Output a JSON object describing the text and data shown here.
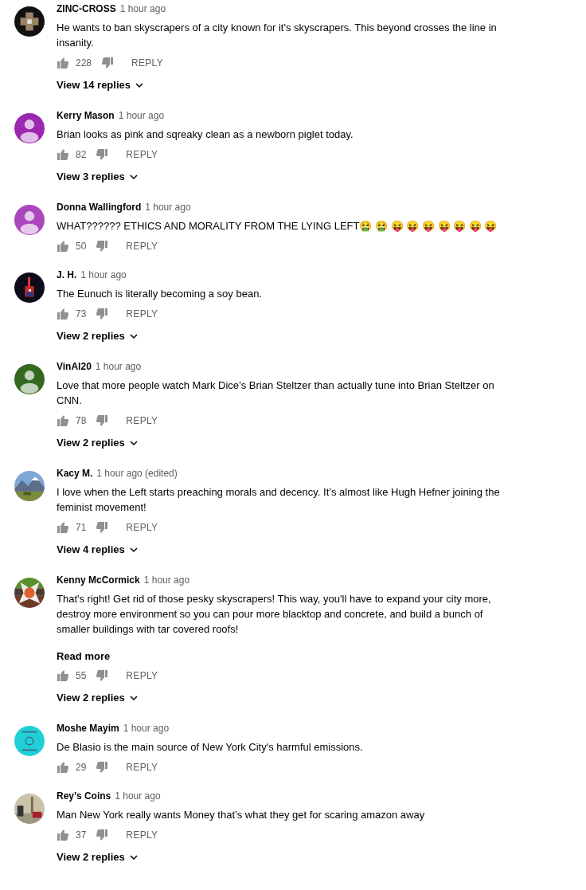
{
  "comments": [
    {
      "author": "ZINC-CROSS",
      "time": "1 hour ago",
      "text": "He wants to ban skyscrapers of a city known for it's skyscrapers. This beyond crosses the line in insanity.",
      "likes": "228",
      "reply": "REPLY",
      "replies": "View 14 replies"
    },
    {
      "author": "Kerry Mason",
      "time": "1 hour ago",
      "avatar": {
        "kind": "silhouette",
        "color": "#9c27b0"
      },
      "text": "Brian looks as pink and sqreaky clean as a newborn piglet today.",
      "likes": "82",
      "reply": "REPLY",
      "replies": "View 3 replies"
    },
    {
      "author": "Donna Wallingford",
      "time": "1 hour ago",
      "avatar": {
        "kind": "silhouette",
        "color": "#ab47bc"
      },
      "text": "WHAT?????? ETHICS AND MORALITY FROM THE LYING LEFT🤮 🤮 😝 😝 😝 😝 😝 😝 😝",
      "likes": "50",
      "reply": "REPLY"
    },
    {
      "author": "J. H.",
      "time": "1 hour ago",
      "text": "The Eunuch is literally becoming a soy bean.",
      "likes": "73",
      "reply": "REPLY",
      "replies": "View 2 replies"
    },
    {
      "author": "VinAl20",
      "time": "1 hour ago",
      "avatar": {
        "kind": "silhouette",
        "color": "#33691e"
      },
      "text": "Love that more people watch Mark Dice’s Brian Steltzer than actually tune into Brian Steltzer on CNN.",
      "likes": "78",
      "reply": "REPLY",
      "replies": "View 2 replies"
    },
    {
      "author": "Kacy M.",
      "time": "1 hour ago (edited)",
      "text": "I love when the Left starts preaching morals and decency. It’s almost like Hugh Hefner joining the feminist movement!",
      "likes": "71",
      "reply": "REPLY",
      "replies": "View 4 replies"
    },
    {
      "author": "Kenny McCormick",
      "time": "1 hour ago",
      "text": "That's right! Get rid of those pesky skyscrapers! This way, you'll have to expand your city more, destroy more environment so you can pour more blacktop and concrete, and build a bunch of smaller buildings with tar covered roofs!",
      "read_more": "Read more",
      "likes": "55",
      "reply": "REPLY",
      "replies": "View 2 replies"
    },
    {
      "author": "Moshe Mayim",
      "time": "1 hour ago",
      "text": "De Blasio is the main source of New York City's harmful emissions.",
      "likes": "29",
      "reply": "REPLY"
    },
    {
      "author": "Rey’s Coins",
      "time": "1 hour ago",
      "text": "Man New York really wants Money that’s what they get for scaring amazon away",
      "likes": "37",
      "reply": "REPLY",
      "replies": "View 2 replies"
    }
  ]
}
